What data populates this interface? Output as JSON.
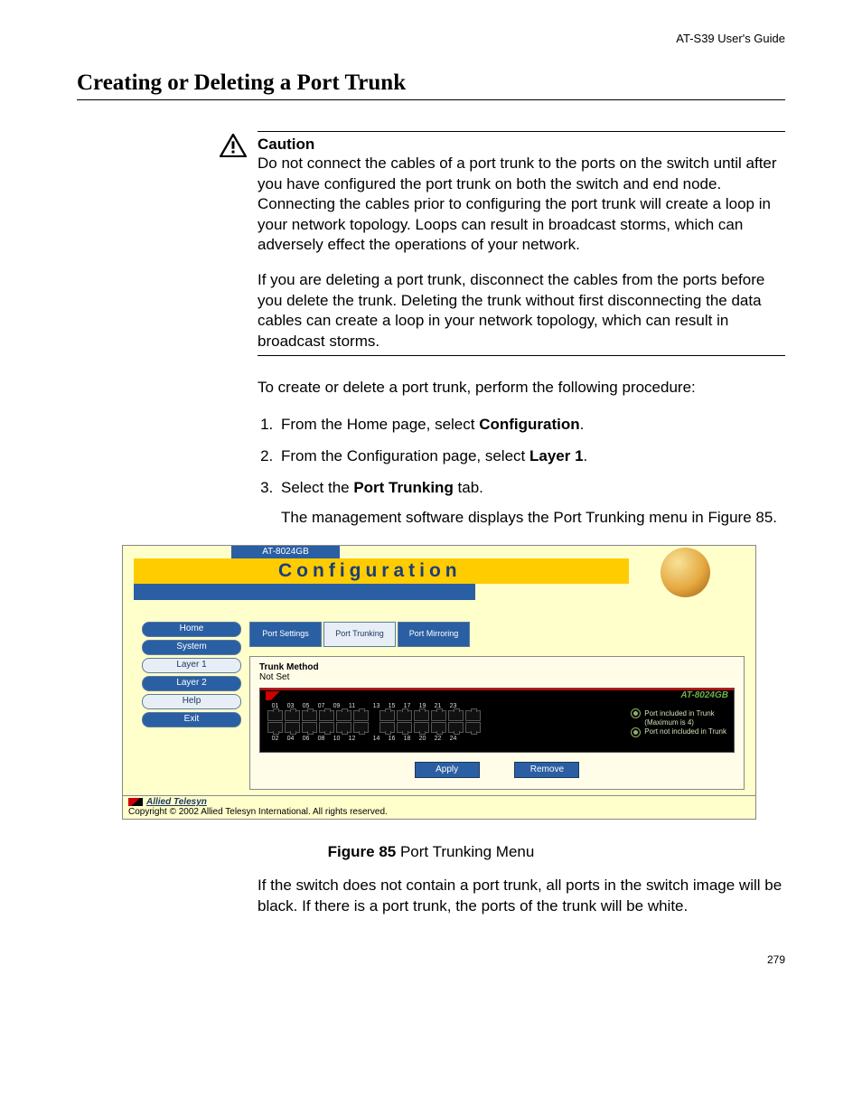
{
  "header": "AT-S39 User's Guide",
  "page_number": "279",
  "section_title": "Creating or Deleting a Port Trunk",
  "caution": {
    "label": "Caution",
    "p1": "Do not connect the cables of a port trunk to the ports on the switch until after you have configured the port trunk on both the switch and end node. Connecting the cables prior to configuring the port trunk will create a loop in your network topology. Loops can result in broadcast storms, which can adversely effect the operations of your network.",
    "p2": "If you are deleting a port trunk, disconnect the cables from the ports before you delete the trunk. Deleting the trunk without first disconnecting the data cables can create a loop in your network topology, which can result in broadcast storms."
  },
  "lead": "To create or delete a port trunk, perform the following procedure:",
  "steps": {
    "s1a": "From the Home page, select ",
    "s1b": "Configuration",
    "s1c": ".",
    "s2a": "From the Configuration page, select ",
    "s2b": "Layer 1",
    "s2c": ".",
    "s3a": "Select the ",
    "s3b": "Port Trunking",
    "s3c": " tab.",
    "s3sub": "The management software displays the Port Trunking menu in Figure 85."
  },
  "figure": {
    "model_tab": "AT-8024GB",
    "title_bar": "Configuration",
    "nav": {
      "home": "Home",
      "system": "System",
      "layer1": "Layer 1",
      "layer2": "Layer 2",
      "help": "Help",
      "exit": "Exit"
    },
    "tabs": {
      "settings": "Port Settings",
      "trunking": "Port Trunking",
      "mirroring": "Port Mirroring"
    },
    "trunk_method_label": "Trunk Method",
    "trunk_method_value": "Not Set",
    "device_model": "AT-8024GB",
    "ports_top": [
      "01",
      "03",
      "05",
      "07",
      "09",
      "11",
      "13",
      "15",
      "17",
      "19",
      "21",
      "23"
    ],
    "ports_bot": [
      "02",
      "04",
      "06",
      "08",
      "10",
      "12",
      "14",
      "16",
      "18",
      "20",
      "22",
      "24"
    ],
    "legend1": "Port included in Trunk",
    "legend1b": "(Maximum is 4)",
    "legend2": "Port not included in Trunk",
    "apply": "Apply",
    "remove": "Remove",
    "brand": "Allied Telesyn",
    "copyright": "Copyright © 2002 Allied Telesyn International. All rights reserved."
  },
  "figure_caption_b": "Figure 85",
  "figure_caption_r": "  Port Trunking Menu",
  "after_fig": "If the switch does not contain a port trunk, all ports in the switch image will be black. If there is a port trunk, the ports of the trunk will be white."
}
